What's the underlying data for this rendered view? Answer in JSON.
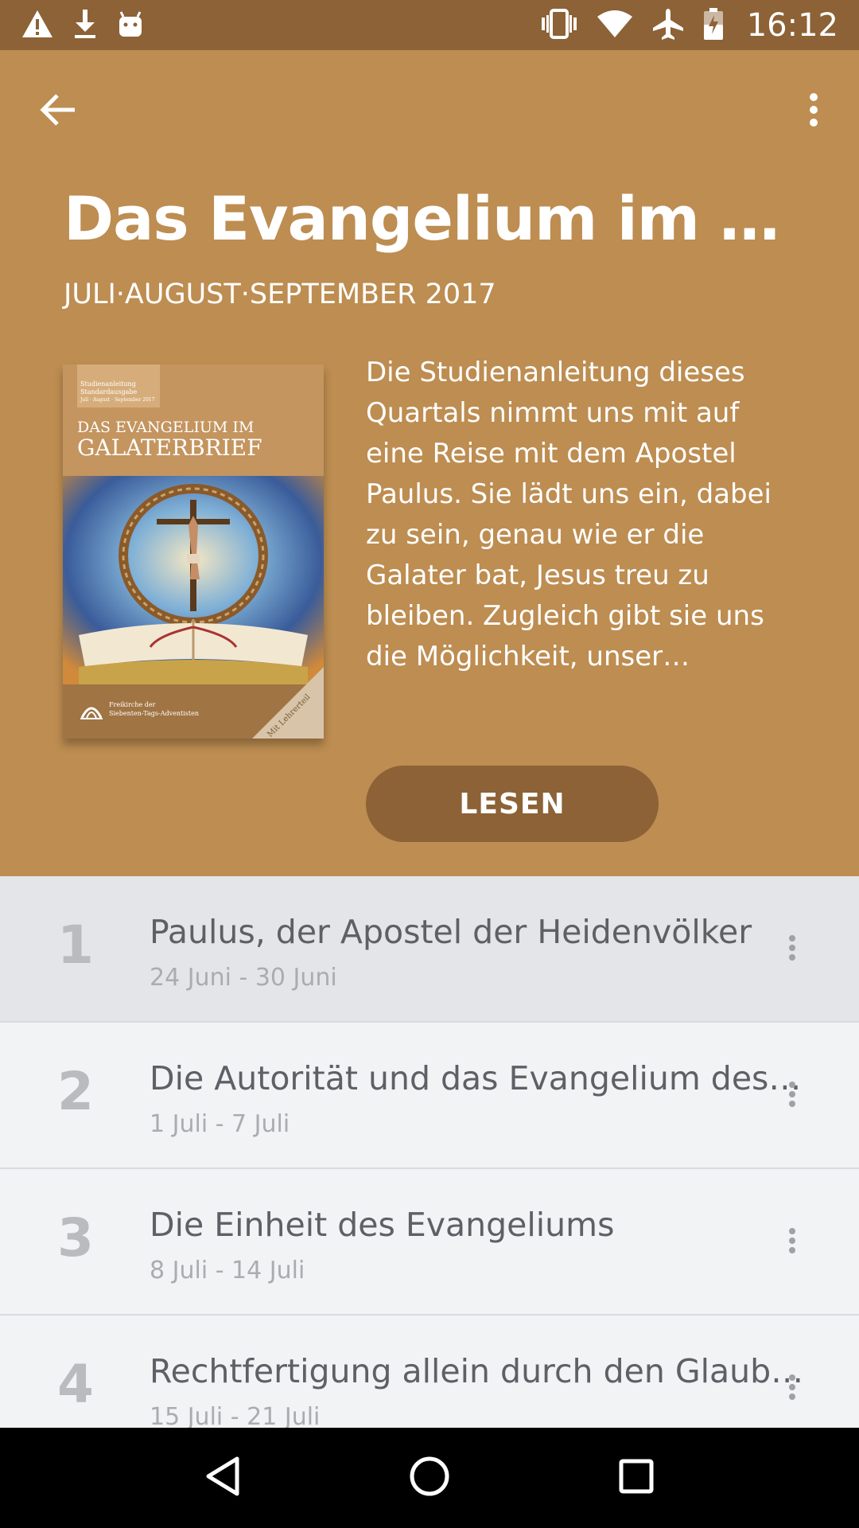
{
  "status_bar": {
    "time": "16:12",
    "left_icons": [
      "warning-icon",
      "download-icon",
      "android-icon"
    ],
    "right_icons": [
      "vibrate-icon",
      "wifi-icon",
      "airplane-mode-icon",
      "battery-icon"
    ]
  },
  "colors": {
    "status_bar": "#8c6236",
    "header": "#bd8d51",
    "button": "#8c6236",
    "list_bg": "#f1f3f5",
    "list_active": "#e3e5e8"
  },
  "header": {
    "title": "Das Evangelium im Galaterbrief",
    "quarter": "JULI·AUGUST·SEPTEMBER 2017",
    "description": "Die Studienanleitung dieses Quartals nimmt uns mit auf eine Reise mit dem Apostel Paulus. Sie lädt uns ein, dabei zu sein, genau wie er die Galater bat, Jesus treu zu bleiben. Zugleich gibt sie uns die Möglichkeit, unser…",
    "read_button": "LESEN"
  },
  "cover": {
    "badge_line1": "Studienanleitung",
    "badge_line2": "Standardausgabe",
    "badge_line3": "Juli · August · September 2017",
    "title_line1": "DAS EVANGELIUM IM",
    "title_line2": "GALATERBRIEF",
    "publisher_line1": "Freikirche der",
    "publisher_line2": "Siebenten-Tags-Adventisten",
    "corner_text": "Mit Lehrerteil"
  },
  "lessons": [
    {
      "number": "1",
      "title": "Paulus, der Apostel der Heidenvölker",
      "dates": "24 Juni - 30 Juni"
    },
    {
      "number": "2",
      "title": "Die Autorität und das Evangelium des Paulus",
      "dates": "1 Juli - 7 Juli"
    },
    {
      "number": "3",
      "title": "Die Einheit des Evangeliums",
      "dates": "8 Juli - 14 Juli"
    },
    {
      "number": "4",
      "title": "Rechtfertigung allein durch den Glauben",
      "dates": "15 Juli - 21 Juli"
    }
  ],
  "nav_bar": [
    "back-triangle-icon",
    "home-circle-icon",
    "recents-square-icon"
  ]
}
